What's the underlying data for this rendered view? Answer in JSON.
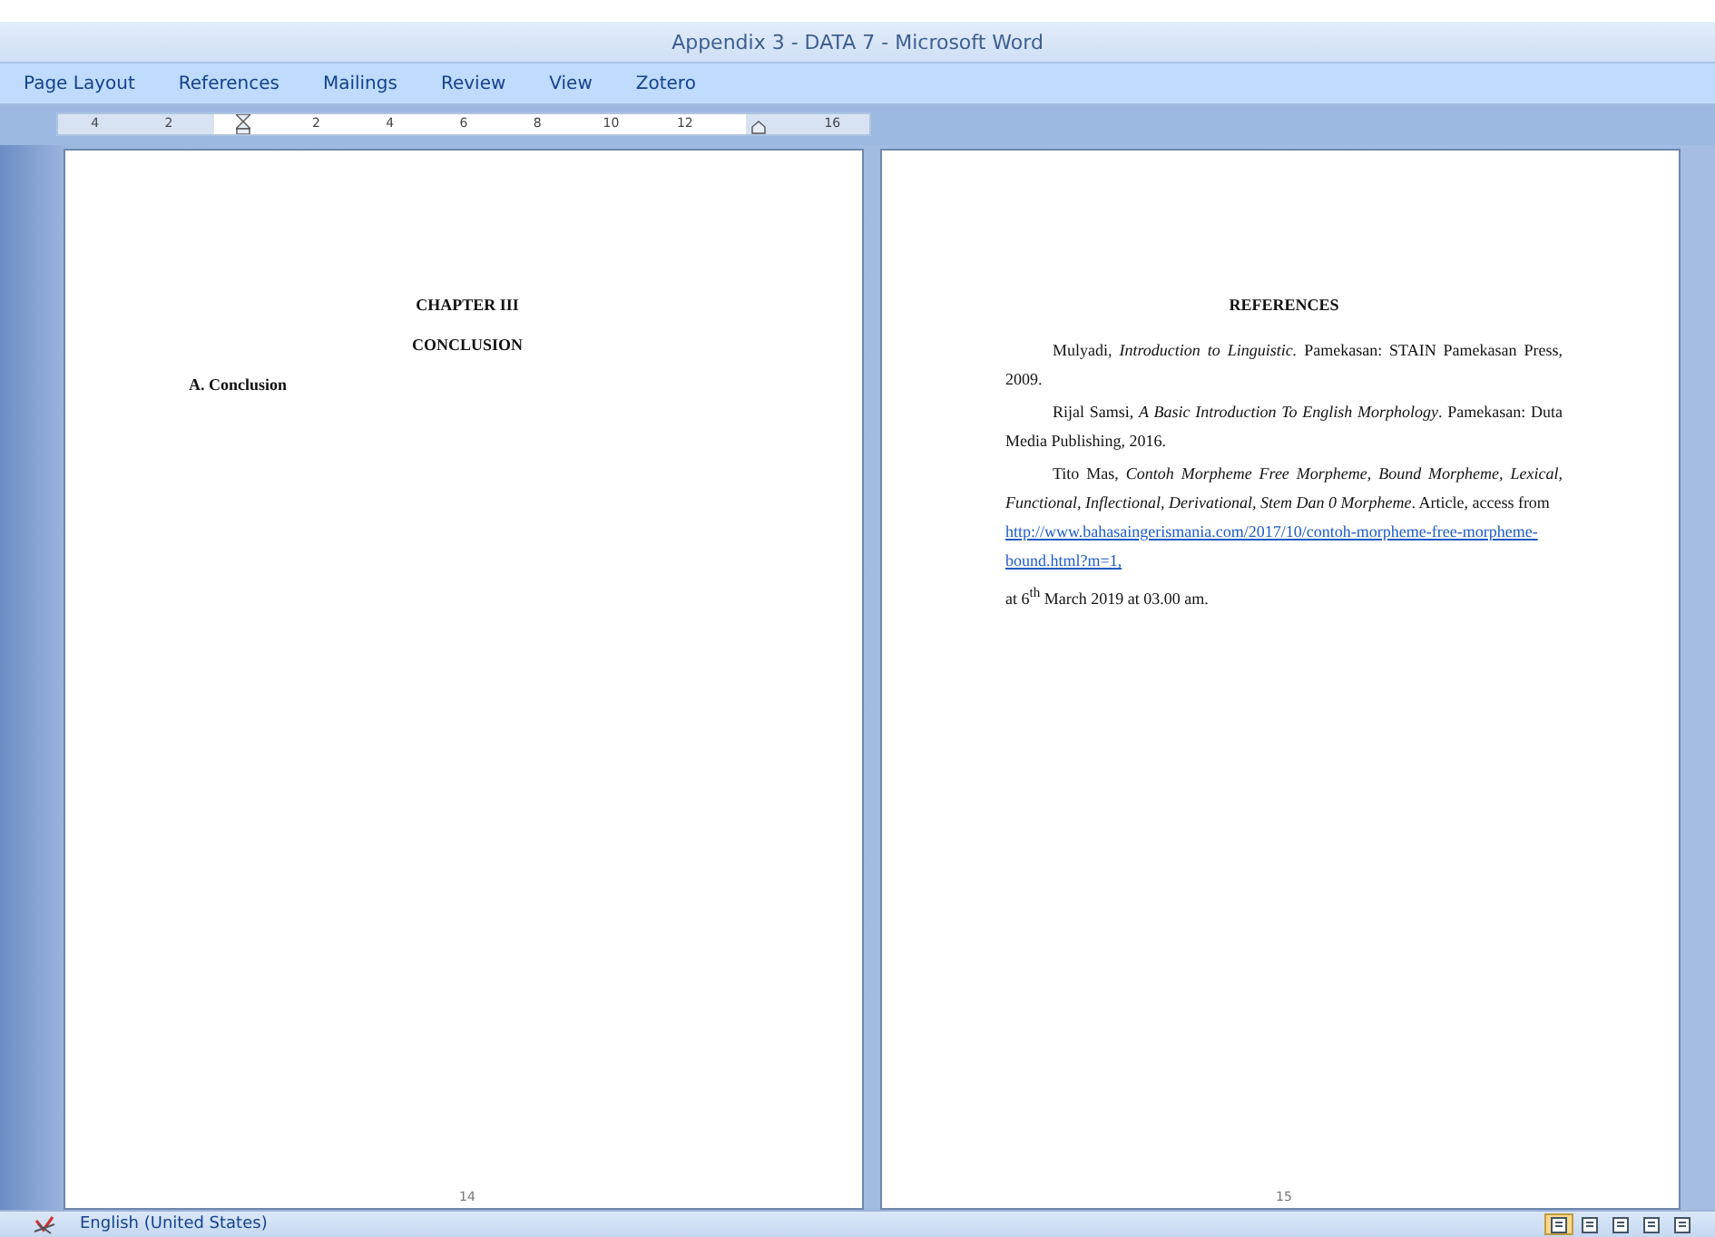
{
  "window": {
    "title": "Appendix 3 - DATA 7 - Microsoft Word"
  },
  "tabs": [
    {
      "label": "Page Layout",
      "selected": false
    },
    {
      "label": "References",
      "selected": false
    },
    {
      "label": "Mailings",
      "selected": false
    },
    {
      "label": "Review",
      "selected": false
    },
    {
      "label": "View",
      "selected": false
    },
    {
      "label": "Zotero",
      "selected": false
    }
  ],
  "ruler": [
    {
      "kind": "number",
      "label": "4"
    },
    {
      "kind": "number",
      "label": "2"
    },
    {
      "kind": "indent"
    },
    {
      "kind": "number",
      "label": "2"
    },
    {
      "kind": "number",
      "label": "4"
    },
    {
      "kind": "number",
      "label": "6"
    },
    {
      "kind": "number",
      "label": "8"
    },
    {
      "kind": "number",
      "label": "10"
    },
    {
      "kind": "number",
      "label": "12"
    },
    {
      "kind": "margin"
    },
    {
      "kind": "number",
      "label": "16"
    }
  ],
  "pages": [
    {
      "blocks": [
        {
          "kind": "center",
          "text": "CHAPTER III"
        },
        {
          "kind": "center",
          "text": "CONCLUSION"
        },
        {
          "kind": "subheading",
          "text": "A. Conclusion"
        }
      ],
      "page_number": "14"
    },
    {
      "blocks": [
        {
          "kind": "center",
          "text": "REFERENCES"
        },
        {
          "kind": "entry",
          "text": "Mulyadi, *Introduction to Linguistic.* Pamekasan: STAIN Pamekasan Press, 2009."
        },
        {
          "kind": "entry",
          "text": "Rijal Samsi, *A Basic Introduction To English Morphology*. Pamekasan: Duta Media Publishing, 2016."
        },
        {
          "kind": "entry",
          "text": "Tito Mas, *Contoh Morpheme Free Morpheme, Bound Morpheme, Lexical, Functional, Inflectional, Derivational, Stem Dan 0 Morpheme*. Article, access from",
          "link": "http://www.bahasaingerismania.com/2017/10/contoh-morpheme-free-morpheme-bound.html?m=1,"
        },
        {
          "kind": "plain",
          "text": "at 6$^{th}$ March 2019 at 03.00 am."
        }
      ],
      "page_number": "15"
    }
  ],
  "status_bar": {
    "language": "English (United States)",
    "views": [
      {
        "selected": true
      },
      {
        "selected": false
      },
      {
        "selected": false
      },
      {
        "selected": false
      },
      {
        "selected": false
      }
    ]
  }
}
